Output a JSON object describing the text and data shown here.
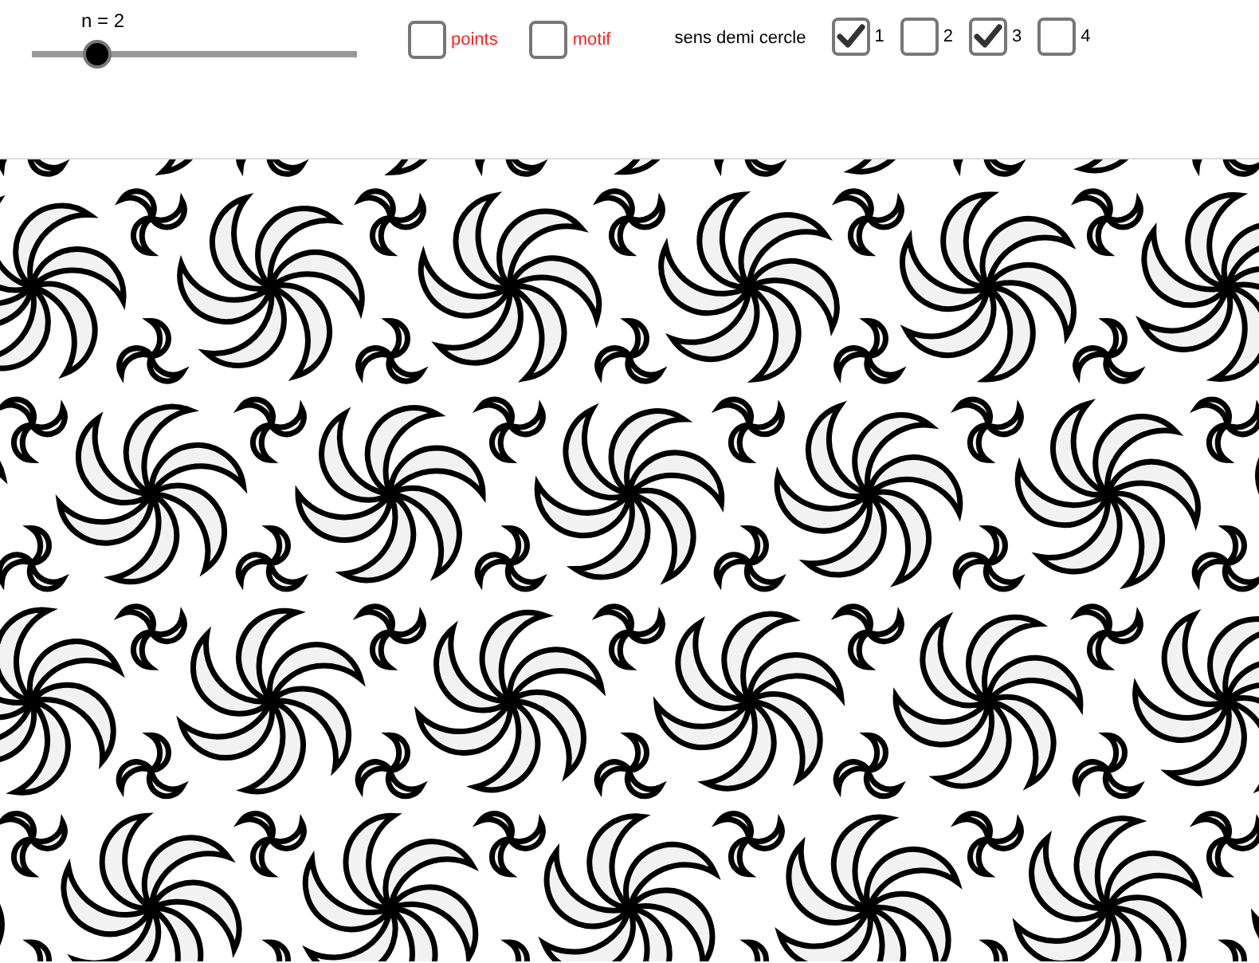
{
  "slider": {
    "label": "n = 2",
    "level": 0.2
  },
  "options": [
    {
      "label": "points",
      "checked": false
    },
    {
      "label": "motif",
      "checked": false
    }
  ],
  "direction": {
    "label": "sens demi cercle",
    "boxes": [
      {
        "label": "1",
        "checked": true
      },
      {
        "label": "2",
        "checked": false
      },
      {
        "label": "3",
        "checked": true
      },
      {
        "label": "4",
        "checked": false
      }
    ]
  }
}
